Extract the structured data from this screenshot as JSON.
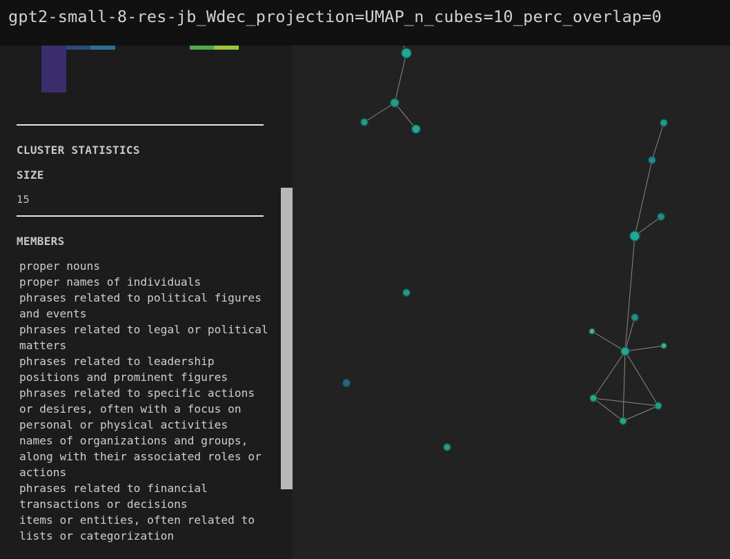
{
  "window": {
    "title": "gpt2-small-8-res-jb_Wdec_projection=UMAP_n_cubes=10_perc_overlap=0"
  },
  "sidebar": {
    "histogram_colors": [
      "#3c2d6e",
      "#2c4a78",
      "#2f6f96",
      "#4fa84a",
      "#9ac43a"
    ],
    "cluster_statistics_heading": "CLUSTER STATISTICS",
    "size_label": "SIZE",
    "size_value": "15",
    "members_heading": "MEMBERS",
    "members": [
      "proper nouns",
      "proper names of individuals",
      "phrases related to political figures and events",
      "phrases related to legal or political matters",
      "phrases related to leadership positions and prominent figures",
      "phrases related to specific actions or desires, often with a focus on personal or physical activities",
      "names of organizations and groups, along with their associated roles or actions",
      "phrases related to financial transactions or decisions",
      "items or entities, often related to lists or categorization"
    ]
  },
  "graph": {
    "node_color": "#1f9e8a",
    "edge_color": "#8a8a8a"
  }
}
